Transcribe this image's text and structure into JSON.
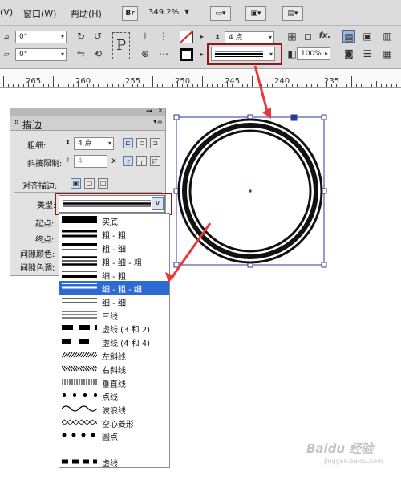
{
  "menubar": {
    "items": [
      {
        "label": "(V)"
      },
      {
        "label": "窗口(W)"
      },
      {
        "label": "帮助(H)"
      }
    ],
    "br_label": "Br",
    "zoom": "349.2%",
    "zoom_arrow": "▼"
  },
  "control": {
    "rotate_angle": "0°",
    "shear_angle": "0°",
    "stroke_weight": "4 点",
    "opacity": "100%",
    "p_glyph": "P"
  },
  "ruler": {
    "labels": [
      "265",
      "260",
      "255",
      "250",
      "245",
      "240",
      "235"
    ]
  },
  "panel": {
    "title": "描边",
    "collapse": "◂◂",
    "close": "✕",
    "weight_label": "粗细:",
    "weight_value": "4 点",
    "miter_label": "斜接限制:",
    "miter_value": "4",
    "miter_x": "x",
    "align_label": "对齐描边:",
    "type_label": "类型:",
    "start_label": "起点:",
    "end_label": "终点:",
    "gap_color_label": "间隙颜色:",
    "gap_tint_label": "间隙色调:"
  },
  "stroke_types": [
    {
      "name": "实底",
      "icon": "solid"
    },
    {
      "name": "粗 - 粗",
      "icon": "thick-thick"
    },
    {
      "name": "粗 - 细",
      "icon": "thick-thin"
    },
    {
      "name": "粗 - 细 - 粗",
      "icon": "thick-thin-thick"
    },
    {
      "name": "细 - 粗",
      "icon": "thin-thick"
    },
    {
      "name": "细 - 粗 - 细",
      "icon": "thin-thick-thin",
      "selected": true
    },
    {
      "name": "细 - 细",
      "icon": "thin-thin"
    },
    {
      "name": "三线",
      "icon": "triple"
    },
    {
      "name": "虚线 (3 和 2)",
      "icon": "dashed-3-2"
    },
    {
      "name": "虚线 (4 和 4)",
      "icon": "dashed-4-4"
    },
    {
      "name": "左斜线",
      "icon": "left-slant-hash"
    },
    {
      "name": "右斜线",
      "icon": "right-slant-hash"
    },
    {
      "name": "垂直线",
      "icon": "straight-hash"
    },
    {
      "name": "点线",
      "icon": "dotted"
    },
    {
      "name": "波浪线",
      "icon": "wavy"
    },
    {
      "name": "空心菱形",
      "icon": "white-diamond"
    },
    {
      "name": "圆点",
      "icon": "japanese-dots"
    },
    {
      "name": "",
      "icon": "blank"
    },
    {
      "name": "虚线",
      "icon": "dashed"
    }
  ],
  "watermark": {
    "text": "Baidu 经验",
    "sub": "jingyan.baidu.com"
  },
  "colors": {
    "selection": "#2d6bd1",
    "highlight": "#8b1a1a",
    "arrow": "#e8383b",
    "frame": "#2a3a9a"
  }
}
